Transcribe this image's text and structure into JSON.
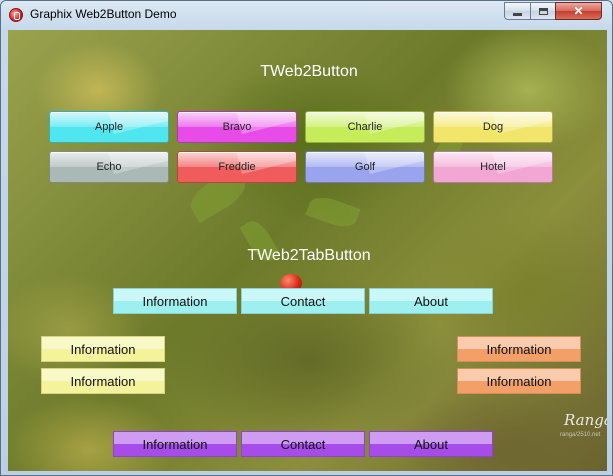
{
  "window": {
    "title": "Graphix Web2Button Demo"
  },
  "titlebar_buttons": {
    "close_glyph": "✕"
  },
  "web2button": {
    "title": "TWeb2Button",
    "buttons": [
      {
        "label": "Apple",
        "color": "#4fe6f0"
      },
      {
        "label": "Bravo",
        "color": "#e84ce8"
      },
      {
        "label": "Charlie",
        "color": "#c6ec5a"
      },
      {
        "label": "Dog",
        "color": "#f2e66a"
      },
      {
        "label": "Echo",
        "color": "#aab8b6"
      },
      {
        "label": "Freddie",
        "color": "#f05c5c"
      },
      {
        "label": "Golf",
        "color": "#9aa4ee"
      },
      {
        "label": "Hotel",
        "color": "#f2a6d4"
      }
    ]
  },
  "web2tabbutton": {
    "title": "TWeb2TabButton",
    "top_tabs": [
      {
        "label": "Information",
        "color": "#9ef0f0"
      },
      {
        "label": "Contact",
        "color": "#9ef0f0"
      },
      {
        "label": "About",
        "color": "#9ef0f0"
      }
    ],
    "left_tabs": [
      {
        "label": "Information",
        "color": "#f4f29a"
      },
      {
        "label": "Information",
        "color": "#f4f29a"
      }
    ],
    "right_tabs": [
      {
        "label": "Information",
        "color": "#f2a068"
      },
      {
        "label": "Information",
        "color": "#f2a068"
      }
    ],
    "bottom_tabs": [
      {
        "label": "Information",
        "color": "#a64ce8"
      },
      {
        "label": "Contact",
        "color": "#a64ce8"
      },
      {
        "label": "About",
        "color": "#a64ce8"
      }
    ]
  },
  "watermark": {
    "logo": "Ranga",
    "sub": "ranga/2510.net"
  }
}
